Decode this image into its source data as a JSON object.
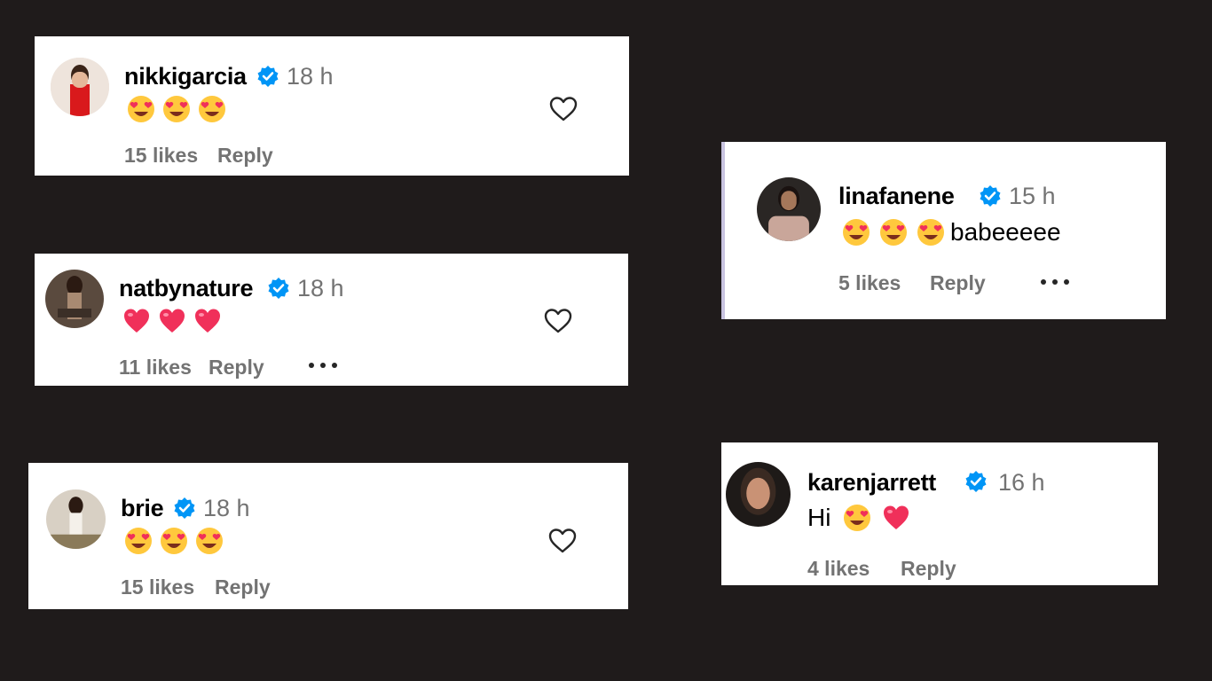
{
  "comments": [
    {
      "username": "nikkigarcia",
      "time": "18 h",
      "text": "",
      "emojis": [
        "heart-eyes",
        "heart-eyes",
        "heart-eyes"
      ],
      "text_after": "",
      "likes": "15 likes",
      "reply": "Reply",
      "has_more": false,
      "has_like_button": true
    },
    {
      "username": "natbynature",
      "time": "18 h",
      "text": "",
      "emojis": [
        "red-heart",
        "red-heart",
        "red-heart"
      ],
      "text_after": "",
      "likes": "11 likes",
      "reply": "Reply",
      "has_more": true,
      "has_like_button": true
    },
    {
      "username": "brie",
      "time": "18 h",
      "text": "",
      "emojis": [
        "heart-eyes",
        "heart-eyes",
        "heart-eyes"
      ],
      "text_after": "",
      "likes": "15 likes",
      "reply": "Reply",
      "has_more": false,
      "has_like_button": true
    },
    {
      "username": "linafanene",
      "time": "15 h",
      "text": "",
      "emojis": [
        "heart-eyes",
        "heart-eyes",
        "heart-eyes"
      ],
      "text_after": "babeeeee",
      "likes": "5 likes",
      "reply": "Reply",
      "has_more": true,
      "has_like_button": false
    },
    {
      "username": "karenjarrett",
      "time": "16 h",
      "text": "Hi",
      "emojis": [
        "heart-eyes",
        "red-heart"
      ],
      "text_after": "",
      "likes": "4 likes",
      "reply": "Reply",
      "has_more": false,
      "has_like_button": false
    }
  ],
  "colors": {
    "background": "#1f1b1b",
    "card": "#ffffff",
    "verified": "#0095f6",
    "meta_text": "#737373",
    "heart_emoji": "#f0305a",
    "emoji_face": "#ffc83d"
  },
  "icons": {
    "verified": "verified-badge-icon",
    "like": "heart-outline-icon",
    "more": "more-dots-icon",
    "heart_eyes": "heart-eyes-emoji",
    "red_heart": "red-heart-emoji"
  }
}
